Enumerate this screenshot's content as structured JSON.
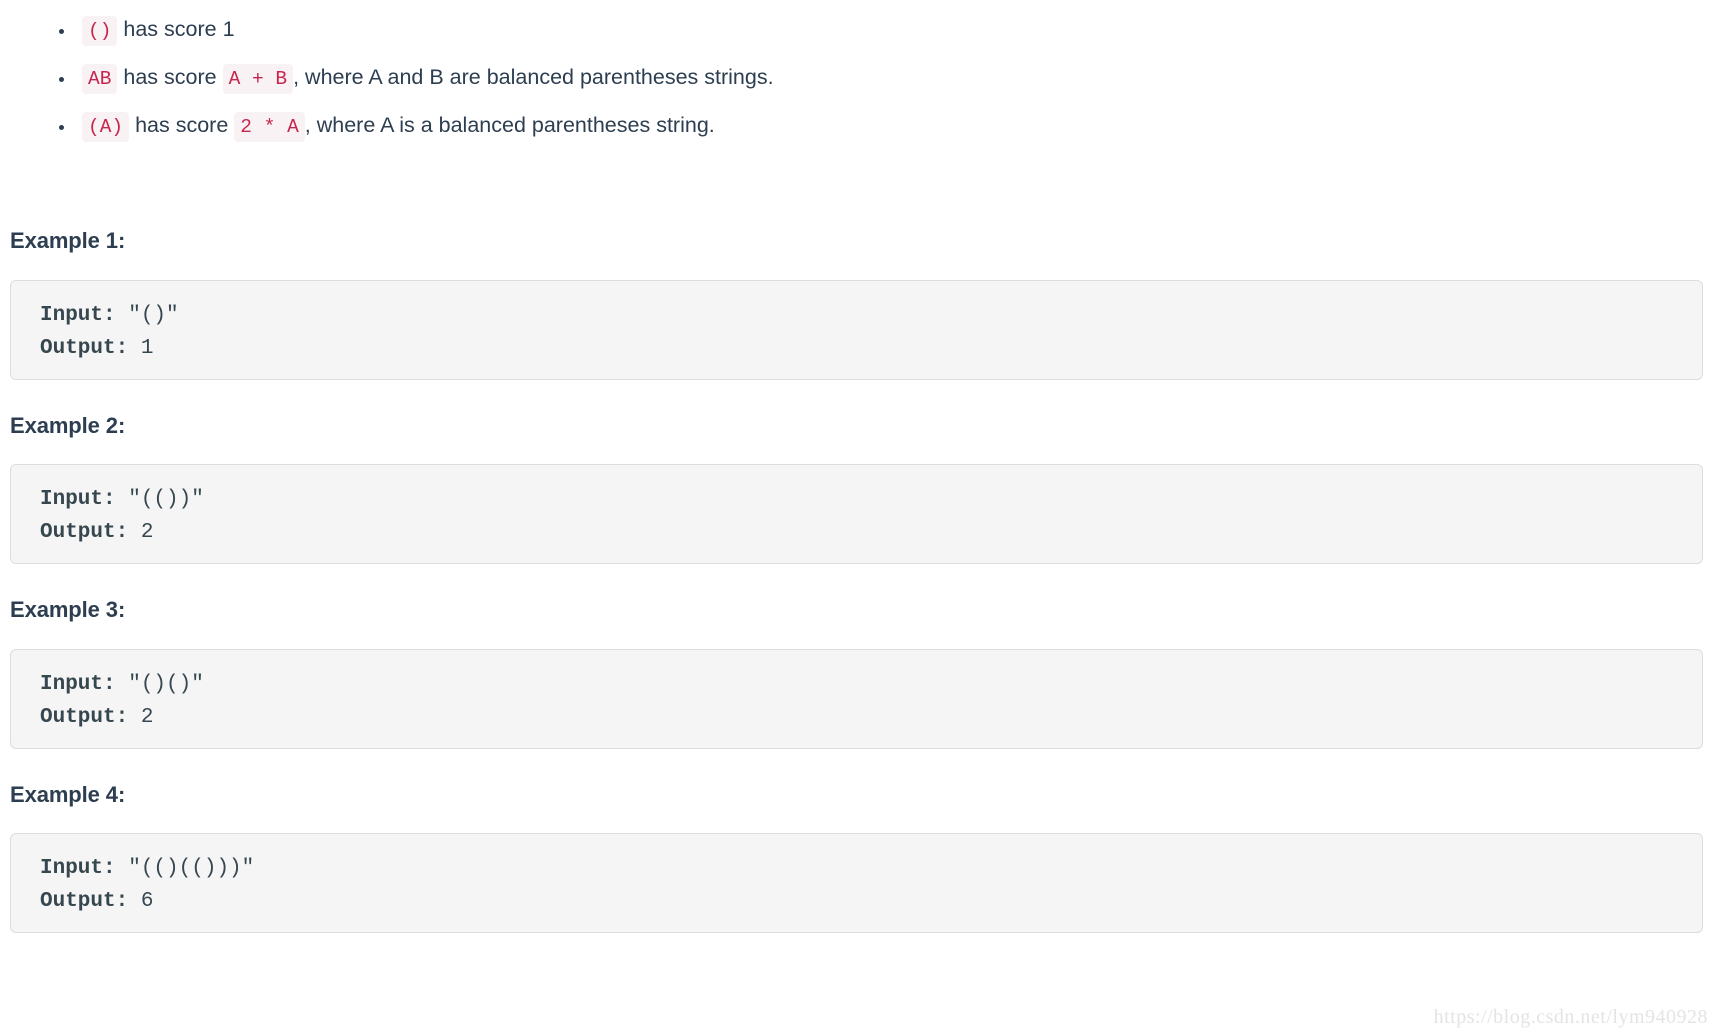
{
  "rules": {
    "items": [
      {
        "code": "()",
        "text_after": " has score 1",
        "code2": null,
        "text_mid": null,
        "text_end": null
      },
      {
        "code": "AB",
        "text_mid": " has score ",
        "code2": "A + B",
        "text_end": ", where A and B are balanced parentheses strings."
      },
      {
        "code": "(A)",
        "text_mid": " has score ",
        "code2": "2 * A",
        "text_end": ", where A is a balanced parentheses string."
      }
    ]
  },
  "examples": [
    {
      "heading": "Example 1:",
      "input_label": "Input:",
      "input_value": " \"()\"",
      "output_label": "Output:",
      "output_value": " 1"
    },
    {
      "heading": "Example 2:",
      "input_label": "Input:",
      "input_value": " \"(())\"",
      "output_label": "Output:",
      "output_value": " 2"
    },
    {
      "heading": "Example 3:",
      "input_label": "Input:",
      "input_value": " \"()()\"",
      "output_label": "Output:",
      "output_value": " 2"
    },
    {
      "heading": "Example 4:",
      "input_label": "Input:",
      "input_value": " \"(()(()))\"",
      "output_label": "Output:",
      "output_value": " 6"
    }
  ],
  "watermark": "https://blog.csdn.net/lym940928",
  "colors": {
    "inline_code_bg": "#f9f2f4",
    "inline_code_fg": "#c7254e",
    "codeblock_bg": "#f5f5f5",
    "codeblock_border": "#dddddd",
    "text": "#2c3e50",
    "watermark": "#e4e4e4"
  }
}
